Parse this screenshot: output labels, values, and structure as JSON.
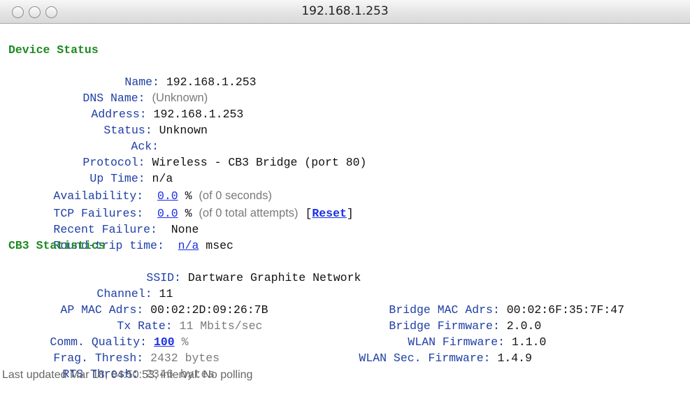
{
  "window": {
    "title": "192.168.1.253"
  },
  "device_status": {
    "heading": "Device Status",
    "name_label": "Name:",
    "name_value": "192.168.1.253",
    "dns_label": "DNS Name:",
    "dns_value": "(Unknown)",
    "address_label": "Address:",
    "address_value": "192.168.1.253",
    "status_label": "Status:",
    "status_value": "Unknown",
    "ack_label": "Ack:",
    "protocol_label": "Protocol:",
    "protocol_value": "Wireless - CB3 Bridge (port 80)",
    "uptime_label": "Up Time:",
    "uptime_value": "n/a",
    "availability_label": "Availability:",
    "availability_value": "0.0",
    "availability_unit": "%",
    "availability_note": "(of 0 seconds)",
    "tcp_label": "TCP Failures:",
    "tcp_value": "0.0",
    "tcp_unit": "%",
    "tcp_note": "(of 0 total attempts)",
    "reset_open": "[",
    "reset_label": "Reset",
    "reset_close": "]",
    "recent_label": "Recent Failure:",
    "recent_value": "None",
    "rtt_label": "Round-trip time:",
    "rtt_value": "n/a",
    "rtt_unit": "msec"
  },
  "cb3_statistics": {
    "heading": "CB3 Statistics",
    "ssid_label": "SSID:",
    "ssid_value": "Dartware Graphite Network",
    "channel_label": "Channel:",
    "channel_value": "11",
    "ap_mac_label": "AP MAC Adrs:",
    "ap_mac_value": "00:02:2D:09:26:7B",
    "bridge_mac_label": "Bridge MAC Adrs:",
    "bridge_mac_value": "00:02:6F:35:7F:47",
    "tx_label": "Tx Rate:",
    "tx_value": "11 Mbits/sec",
    "bridge_fw_label": "Bridge Firmware:",
    "bridge_fw_value": "2.0.0",
    "quality_label": "Comm. Quality:",
    "quality_value": "100",
    "quality_unit": "%",
    "wlan_fw_label": "WLAN Firmware:",
    "wlan_fw_value": "1.1.0",
    "frag_label": "Frag. Thresh:",
    "frag_value": "2432 bytes",
    "wlan_sec_label": "WLAN Sec. Firmware:",
    "wlan_sec_value": "1.4.9",
    "rts_label": "RTS Thresh:",
    "rts_value": "2346 bytes"
  },
  "footer": {
    "text": "Last updated Mar 18, 04:50:53; interval: No polling"
  }
}
